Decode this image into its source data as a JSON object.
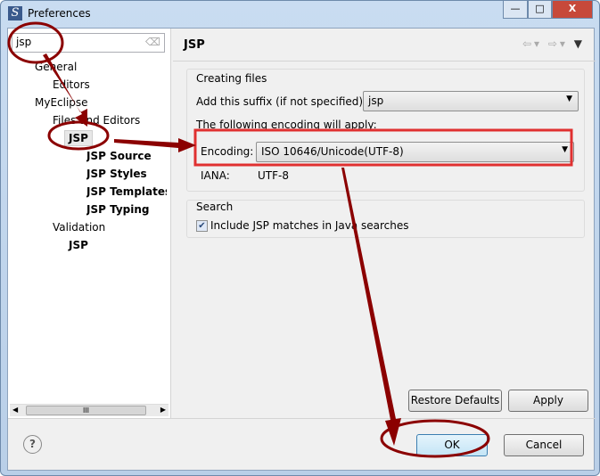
{
  "window": {
    "title": "Preferences",
    "minimize": "—",
    "maximize": "□",
    "close": "X"
  },
  "search": {
    "value": "jsp"
  },
  "tree": [
    {
      "label": "General",
      "level": 1,
      "bold": false
    },
    {
      "label": "Editors",
      "level": 2,
      "bold": false
    },
    {
      "label": "MyEclipse",
      "level": 1,
      "bold": false
    },
    {
      "label": "Files and Editors",
      "level": 2,
      "bold": false
    },
    {
      "label": "JSP",
      "level": 3,
      "bold": true,
      "selected": true
    },
    {
      "label": "JSP Source",
      "level": 4,
      "bold": true
    },
    {
      "label": "JSP Styles",
      "level": 4,
      "bold": true
    },
    {
      "label": "JSP Templates",
      "level": 4,
      "bold": true
    },
    {
      "label": "JSP Typing",
      "level": 4,
      "bold": true
    },
    {
      "label": "Validation",
      "level": 2,
      "bold": false
    },
    {
      "label": "JSP",
      "level": 3,
      "bold": true
    }
  ],
  "scroll_thumb": "III",
  "page": {
    "title": "JSP",
    "creating": {
      "legend": "Creating files",
      "suffix_label": "Add this suffix (if not specified):",
      "suffix_value": "jsp",
      "encoding_note": "The following encoding will apply:",
      "encoding_label": "Encoding:",
      "encoding_value": "ISO 10646/Unicode(UTF-8)",
      "iana_label": "IANA:",
      "iana_value": "UTF-8"
    },
    "search": {
      "legend": "Search",
      "checkbox_label": "Include JSP matches in Java searches",
      "checked": true
    },
    "restore_defaults": "Restore Defaults",
    "apply": "Apply"
  },
  "footer": {
    "help": "?",
    "ok": "OK",
    "cancel": "Cancel"
  },
  "annotation_color": "#8b0000",
  "highlight_color": "#e03030"
}
